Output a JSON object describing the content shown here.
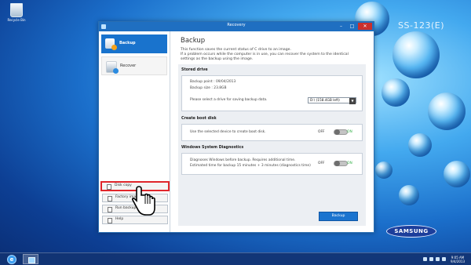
{
  "desktop": {
    "recycle_bin_label": "Recycle Bin",
    "model_text": "SS-123(E)",
    "brand_text": "SAMSUNG"
  },
  "window": {
    "title": "Recovery",
    "controls": {
      "minimize": "–",
      "maximize": "□",
      "close": "✕"
    }
  },
  "sidebar": {
    "items": [
      {
        "label": "Backup",
        "icon": "backup-drive-icon",
        "active": true
      },
      {
        "label": "Recover",
        "icon": "recover-drive-icon",
        "active": false
      }
    ],
    "tools": [
      {
        "label": "Disk copy",
        "icon": "disk-copy-icon",
        "highlighted": true
      },
      {
        "label": "Factory image",
        "icon": "factory-image-icon"
      },
      {
        "label": "Run backup",
        "icon": "run-backup-icon"
      },
      {
        "label": "Help",
        "icon": "help-icon"
      }
    ]
  },
  "main": {
    "heading": "Backup",
    "description": "This function saves the current status of C drive to an image.\nIf a problem occurs while the computer is in use, you can recover the system to the identical settings as the backup using the image.",
    "stored_drive": {
      "title": "Stored drive",
      "backup_point": "Backup point : 09/04/2013",
      "backup_size": "Backup size : 23.8GB",
      "instruction": "Please select a drive for saving backup data.",
      "selected_drive": "D:\\ (158.4GB left)"
    },
    "boot_disk": {
      "title": "Create boot disk",
      "text": "Use the selected device to create boot disk.",
      "off": "OFF",
      "on": "ON"
    },
    "diagnostics": {
      "title": "Windows System Diagnostics",
      "line1": "Diagnoses Windows before backup. Requires additional time.",
      "line2": "Estimated time for backup 15 minutes + 3 minutes (diagnostics time)",
      "off": "OFF",
      "on": "ON"
    },
    "backup_button": "Backup"
  },
  "taskbar": {
    "time": "9:05 AM",
    "date": "9/4/2013"
  },
  "colors": {
    "accent": "#1973cd",
    "highlight_box": "#e0262b",
    "toggle_on": "#36b24a"
  }
}
